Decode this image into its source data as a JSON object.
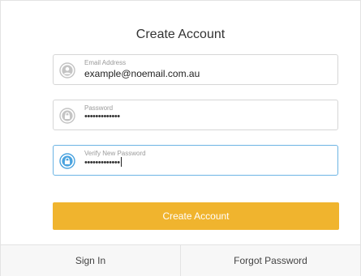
{
  "form": {
    "title": "Create Account",
    "email": {
      "label": "Email Address",
      "value": "example@noemail.com.au",
      "icon": "user-icon"
    },
    "password": {
      "label": "Password",
      "value": "•••••••••••••",
      "icon": "lock-icon"
    },
    "verify_password": {
      "label": "Verify New Password",
      "value": "•••••••••••••",
      "icon": "lock-icon",
      "focused": true
    },
    "submit_label": "Create Account"
  },
  "footer": {
    "sign_in_label": "Sign In",
    "forgot_password_label": "Forgot Password"
  },
  "colors": {
    "accent": "#f0b42e",
    "focus_border": "#6cb4e4",
    "focus_icon": "#4aa3df",
    "icon_gray": "#c4c4c4"
  }
}
